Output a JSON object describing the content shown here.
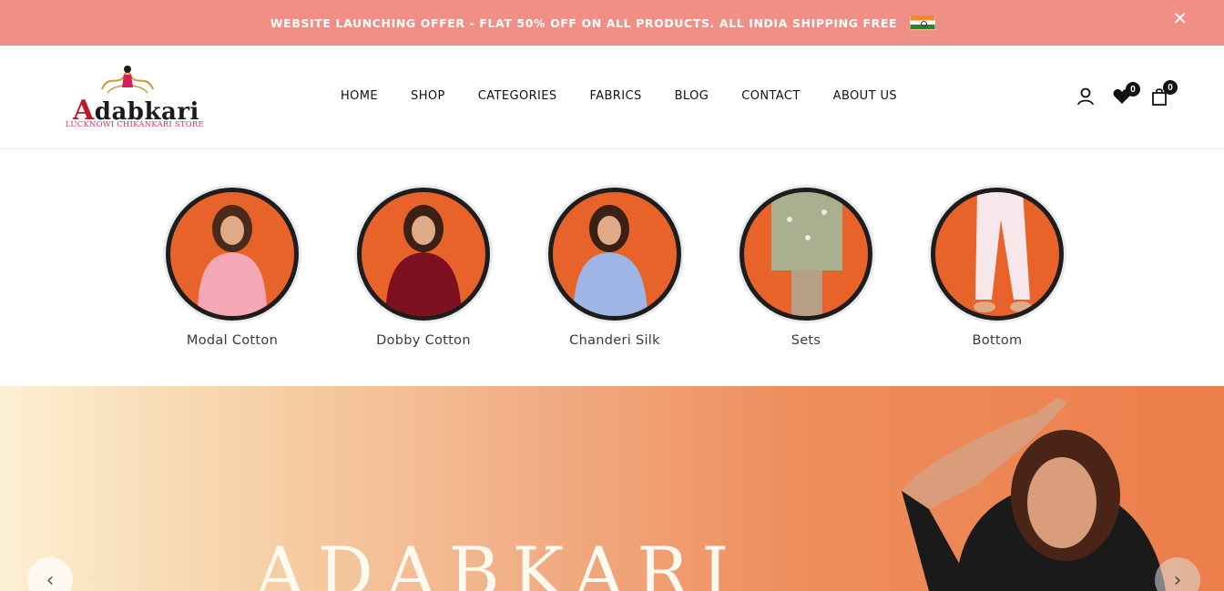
{
  "announcement": {
    "text": "WEBSITE LAUNCHING OFFER - FLAT 50% OFF ON ALL PRODUCTS. ALL INDIA SHIPPING FREE",
    "close_label": "✕",
    "flag_icon": "india-flag-icon",
    "background": "#ef8f85"
  },
  "header": {
    "logo_word": "dabkari",
    "logo_initial": "A",
    "logo_tagline": "LUCKNOWI CHIKANKARI STORE",
    "nav": [
      "HOME",
      "SHOP",
      "CATEGORIES",
      "FABRICS",
      "BLOG",
      "CONTACT",
      "ABOUT US"
    ],
    "icons": {
      "account": "user-icon",
      "wishlist": "heart-icon",
      "cart": "shopping-bag-icon"
    },
    "wishlist_count": "0",
    "cart_count": "0"
  },
  "categories": [
    {
      "label": "Modal Cotton",
      "garment_color": "#f4a8b6"
    },
    {
      "label": "Dobby Cotton",
      "garment_color": "#7d1020"
    },
    {
      "label": "Chanderi Silk",
      "garment_color": "#9fb5e6"
    },
    {
      "label": "Sets",
      "garment_color": "#a9b08f"
    },
    {
      "label": "Bottom",
      "garment_color": "#f7e6ea"
    }
  ],
  "hero": {
    "title": "ADABKARI",
    "prev_label": "‹",
    "next_label": "›"
  },
  "colors": {
    "accent": "#ef8f85",
    "category_bg": "#e8632a",
    "hero_orange": "#ec7e4a"
  }
}
